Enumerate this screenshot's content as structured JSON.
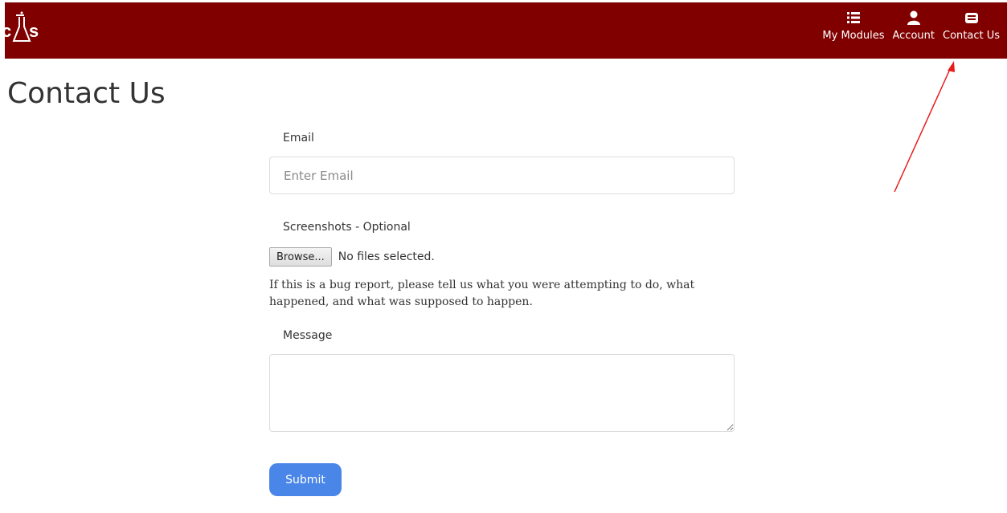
{
  "navbar": {
    "logo_text": "cĀs",
    "items": [
      {
        "label": "My Modules",
        "icon": "list-icon"
      },
      {
        "label": "Account",
        "icon": "user-icon"
      },
      {
        "label": "Contact Us",
        "icon": "envelope-icon"
      }
    ],
    "background_color": "#800000"
  },
  "page": {
    "title": "Contact Us"
  },
  "form": {
    "email_label": "Email",
    "email_placeholder": "Enter Email",
    "email_value": "",
    "screenshots_label": "Screenshots - Optional",
    "browse_label": "Browse...",
    "file_status": "No files selected.",
    "help_text": "If this is a bug report, please tell us what you were attempting to do, what happened, and what was supposed to happen.",
    "message_label": "Message",
    "message_value": "",
    "submit_label": "Submit",
    "submit_color": "#4a86e8"
  },
  "annotation": {
    "arrow_color": "#e81c1c",
    "target": "Contact Us"
  }
}
